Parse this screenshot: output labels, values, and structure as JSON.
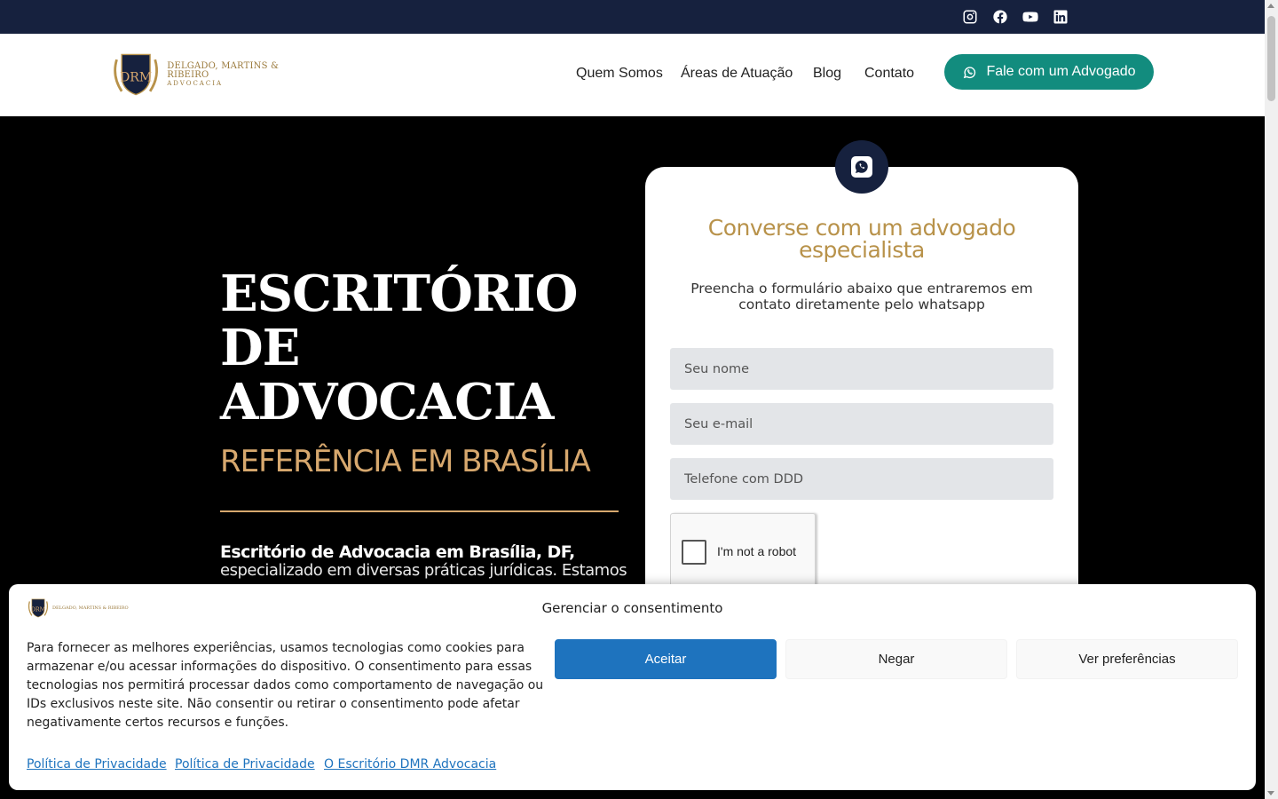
{
  "social_icons": [
    "instagram-icon",
    "facebook-icon",
    "youtube-icon",
    "linkedin-icon"
  ],
  "brand": {
    "monogram": "DRM",
    "name_line1": "DELGADO, MARTINS & RIBEIRO",
    "name_line2": "ADVOCACIA"
  },
  "nav": {
    "items": [
      "Quem Somos",
      "Áreas de Atuação",
      "Blog",
      "Contato"
    ],
    "cta_label": "Fale com um Advogado"
  },
  "hero": {
    "title_line1": "ESCRITÓRIO",
    "title_line2": "DE",
    "title_line3": "ADVOCACIA",
    "subtitle": "REFERÊNCIA EM BRASÍLIA",
    "bold_text": "Escritório de Advocacia em Brasília, DF,",
    "body_text": "especializado em diversas práticas jurídicas. Estamos"
  },
  "form": {
    "title": "Converse com um advogado especialista",
    "description": "Preencha o formulário abaixo que entraremos em contato diretamente pelo whatsapp",
    "name_placeholder": "Seu nome",
    "email_placeholder": "Seu e-mail",
    "phone_placeholder": "Telefone com DDD",
    "captcha_label": "I'm not a robot"
  },
  "cookie": {
    "title": "Gerenciar o consentimento",
    "text": "Para fornecer as melhores experiências, usamos tecnologias como cookies para armazenar e/ou acessar informações do dispositivo. O consentimento para essas tecnologias nos permitirá processar dados como comportamento de navegação ou IDs exclusivos neste site. Não consentir ou retirar o consentimento pode afetar negativamente certos recursos e funções.",
    "accept_label": "Aceitar",
    "deny_label": "Negar",
    "prefs_label": "Ver preferências",
    "links": [
      "Política de Privacidade",
      "Política de Privacidade",
      "O Escritório DMR Advocacia"
    ]
  },
  "colors": {
    "navy": "#16213e",
    "gold": "#d7a86e",
    "whatsapp_green": "#128c7e",
    "accept_blue": "#1e73be"
  }
}
